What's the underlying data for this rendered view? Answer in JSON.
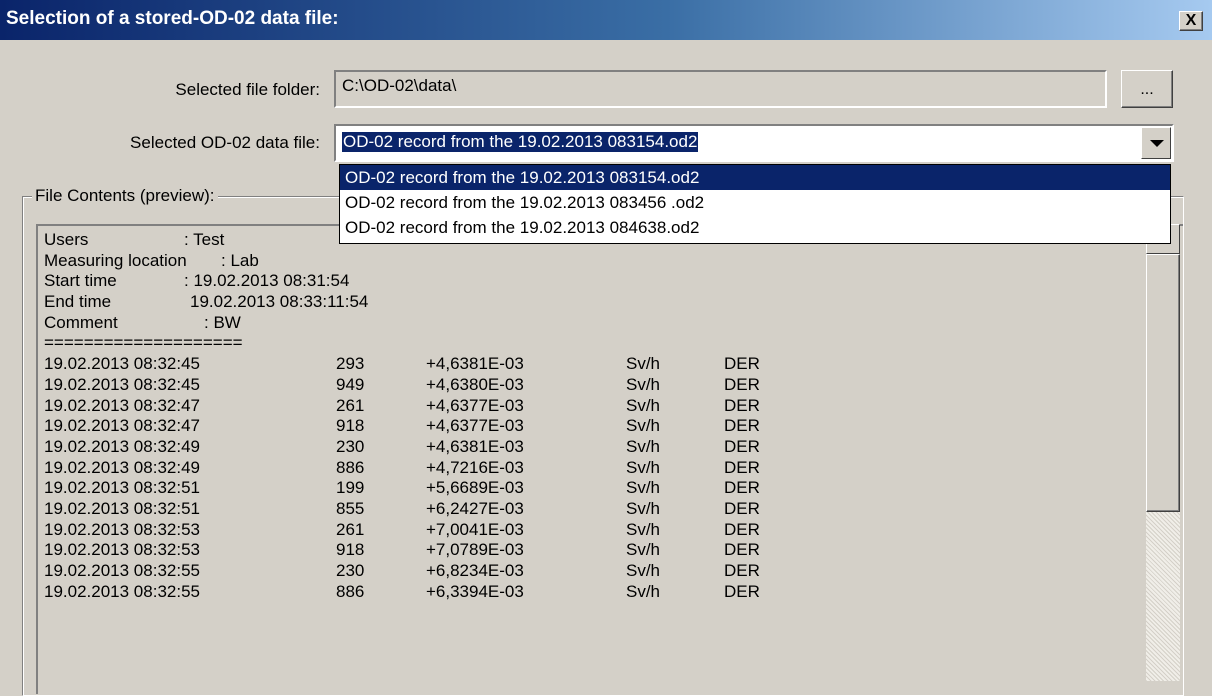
{
  "window": {
    "title": "Selection of a stored-OD-02 data file:",
    "close_label": "X"
  },
  "folder": {
    "label": "Selected file folder:",
    "value": "C:\\OD-02\\data\\",
    "browse_label": "..."
  },
  "file": {
    "label": "Selected OD-02 data file:",
    "value": "OD-02 record from the 19.02.2013 083154.od2",
    "options": [
      "OD-02 record from the 19.02.2013 083154.od2",
      "OD-02 record from the 19.02.2013 083456 .od2",
      "OD-02 record from the 19.02.2013 084638.od2"
    ]
  },
  "preview": {
    "legend": "File Contents (preview):",
    "header": [
      {
        "label": "Users",
        "value": ": Test"
      },
      {
        "label": "Measuring location",
        "value": ": Lab"
      },
      {
        "label": "Start time",
        "value": ": 19.02.2013 08:31:54"
      },
      {
        "label": "End time",
        "value": "19.02.2013 08:33:11:54"
      },
      {
        "label": "Comment",
        "value": ": BW"
      }
    ],
    "separator": "====================",
    "rows": [
      [
        "19.02.2013 08:32:45",
        "293",
        "+4,6381E-03",
        "Sv/h",
        "DER"
      ],
      [
        "19.02.2013 08:32:45",
        "949",
        "+4,6380E-03",
        "Sv/h",
        "DER"
      ],
      [
        "19.02.2013 08:32:47",
        "261",
        "+4,6377E-03",
        "Sv/h",
        "DER"
      ],
      [
        "19.02.2013 08:32:47",
        "918",
        "+4,6377E-03",
        "Sv/h",
        "DER"
      ],
      [
        "19.02.2013 08:32:49",
        "230",
        "+4,6381E-03",
        "Sv/h",
        "DER"
      ],
      [
        "19.02.2013 08:32:49",
        "886",
        "+4,7216E-03",
        "Sv/h",
        "DER"
      ],
      [
        "19.02.2013 08:32:51",
        "199",
        "+5,6689E-03",
        "Sv/h",
        "DER"
      ],
      [
        "19.02.2013 08:32:51",
        "855",
        "+6,2427E-03",
        "Sv/h",
        "DER"
      ],
      [
        "19.02.2013 08:32:53",
        "261",
        "+7,0041E-03",
        "Sv/h",
        "DER"
      ],
      [
        "19.02.2013 08:32:53",
        "918",
        "+7,0789E-03",
        "Sv/h",
        "DER"
      ],
      [
        "19.02.2013 08:32:55",
        "230",
        "+6,8234E-03",
        "Sv/h",
        "DER"
      ],
      [
        "19.02.2013 08:32:55",
        "886",
        "+6,3394E-03",
        "Sv/h",
        "DER"
      ]
    ]
  }
}
